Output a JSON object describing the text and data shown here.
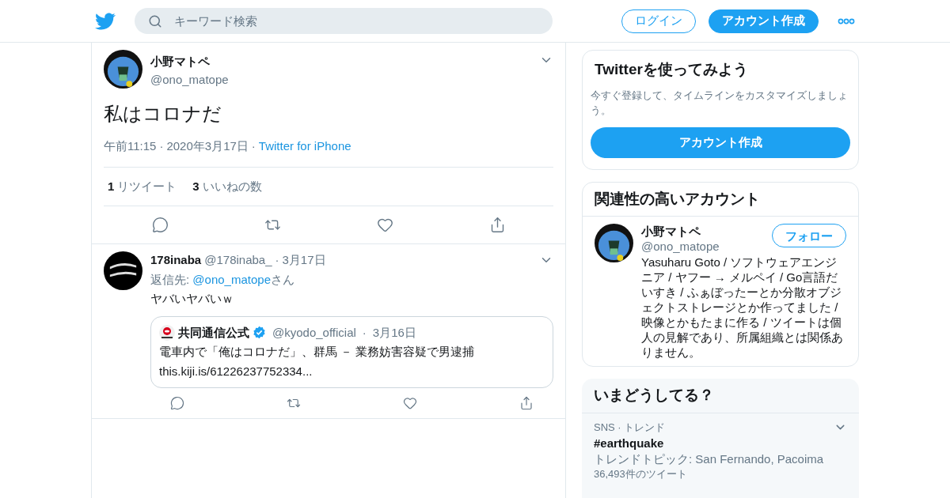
{
  "header": {
    "search": {
      "placeholder": "キーワード検索"
    },
    "buttons": [
      {
        "label": "ログイン",
        "kind": "outline"
      },
      {
        "label": "アカウント作成",
        "kind": "filled"
      }
    ]
  },
  "tweet": {
    "name": "小野マトペ",
    "handle": "@ono_matope",
    "text": "私はコロナだ",
    "meta": [
      {
        "text": "午前11:15",
        "kind": "plain"
      },
      {
        "text": "·",
        "kind": "separator"
      },
      {
        "text": "2020年3月17日",
        "kind": "plain"
      },
      {
        "text": "·",
        "kind": "separator"
      },
      {
        "text": "Twitter for iPhone",
        "kind": "link"
      }
    ],
    "stats": [
      {
        "count": "1",
        "label": "リツイート"
      },
      {
        "count": "3",
        "label": "いいねの数"
      }
    ]
  },
  "replies": [
    {
      "name": "178inaba",
      "handle": "@178inaba_",
      "separator": "·",
      "date": "3月17日",
      "reply_to": {
        "prefix": "返信先: ",
        "handle": "@ono_matope",
        "suffix": "さん"
      },
      "text": "ヤバいヤバいｗ",
      "quote": {
        "name": "共同通信公式",
        "verified": true,
        "handle": "@kyodo_official",
        "separator": "·",
        "date": "3月16日",
        "lines": [
          "電車内で「俺はコロナだ」、群馬 － 業務妨害容疑で男逮捕",
          "this.kiji.is/61226237752334..."
        ]
      }
    }
  ],
  "signup": {
    "title": "Twitterを使ってみよう",
    "text": "今すぐ登録して、タイムラインをカスタマイズしましょう。",
    "button": "アカウント作成"
  },
  "related": {
    "title": "関連性の高いアカウント",
    "accounts": [
      {
        "name": "小野マトペ",
        "handle": "@ono_matope",
        "button": "フォロー",
        "bio": "Yasuharu Goto / ソフトウェアエンジニア / ヤフー → メルペイ / Go言語だいすき / ふぁぼったーとか分散オブジェクトストレージとか作ってました / 映像とかもたまに作る / ツイートは個人の見解であり、所属組織とは関係ありません。"
      }
    ]
  },
  "trends": {
    "title": "いまどうしてる？",
    "items": [
      {
        "context": "SNS · トレンド",
        "name": "#earthquake",
        "description": "トレンドトピック: San Fernando, Pacoima",
        "count": "36,493件のツイート"
      }
    ]
  }
}
